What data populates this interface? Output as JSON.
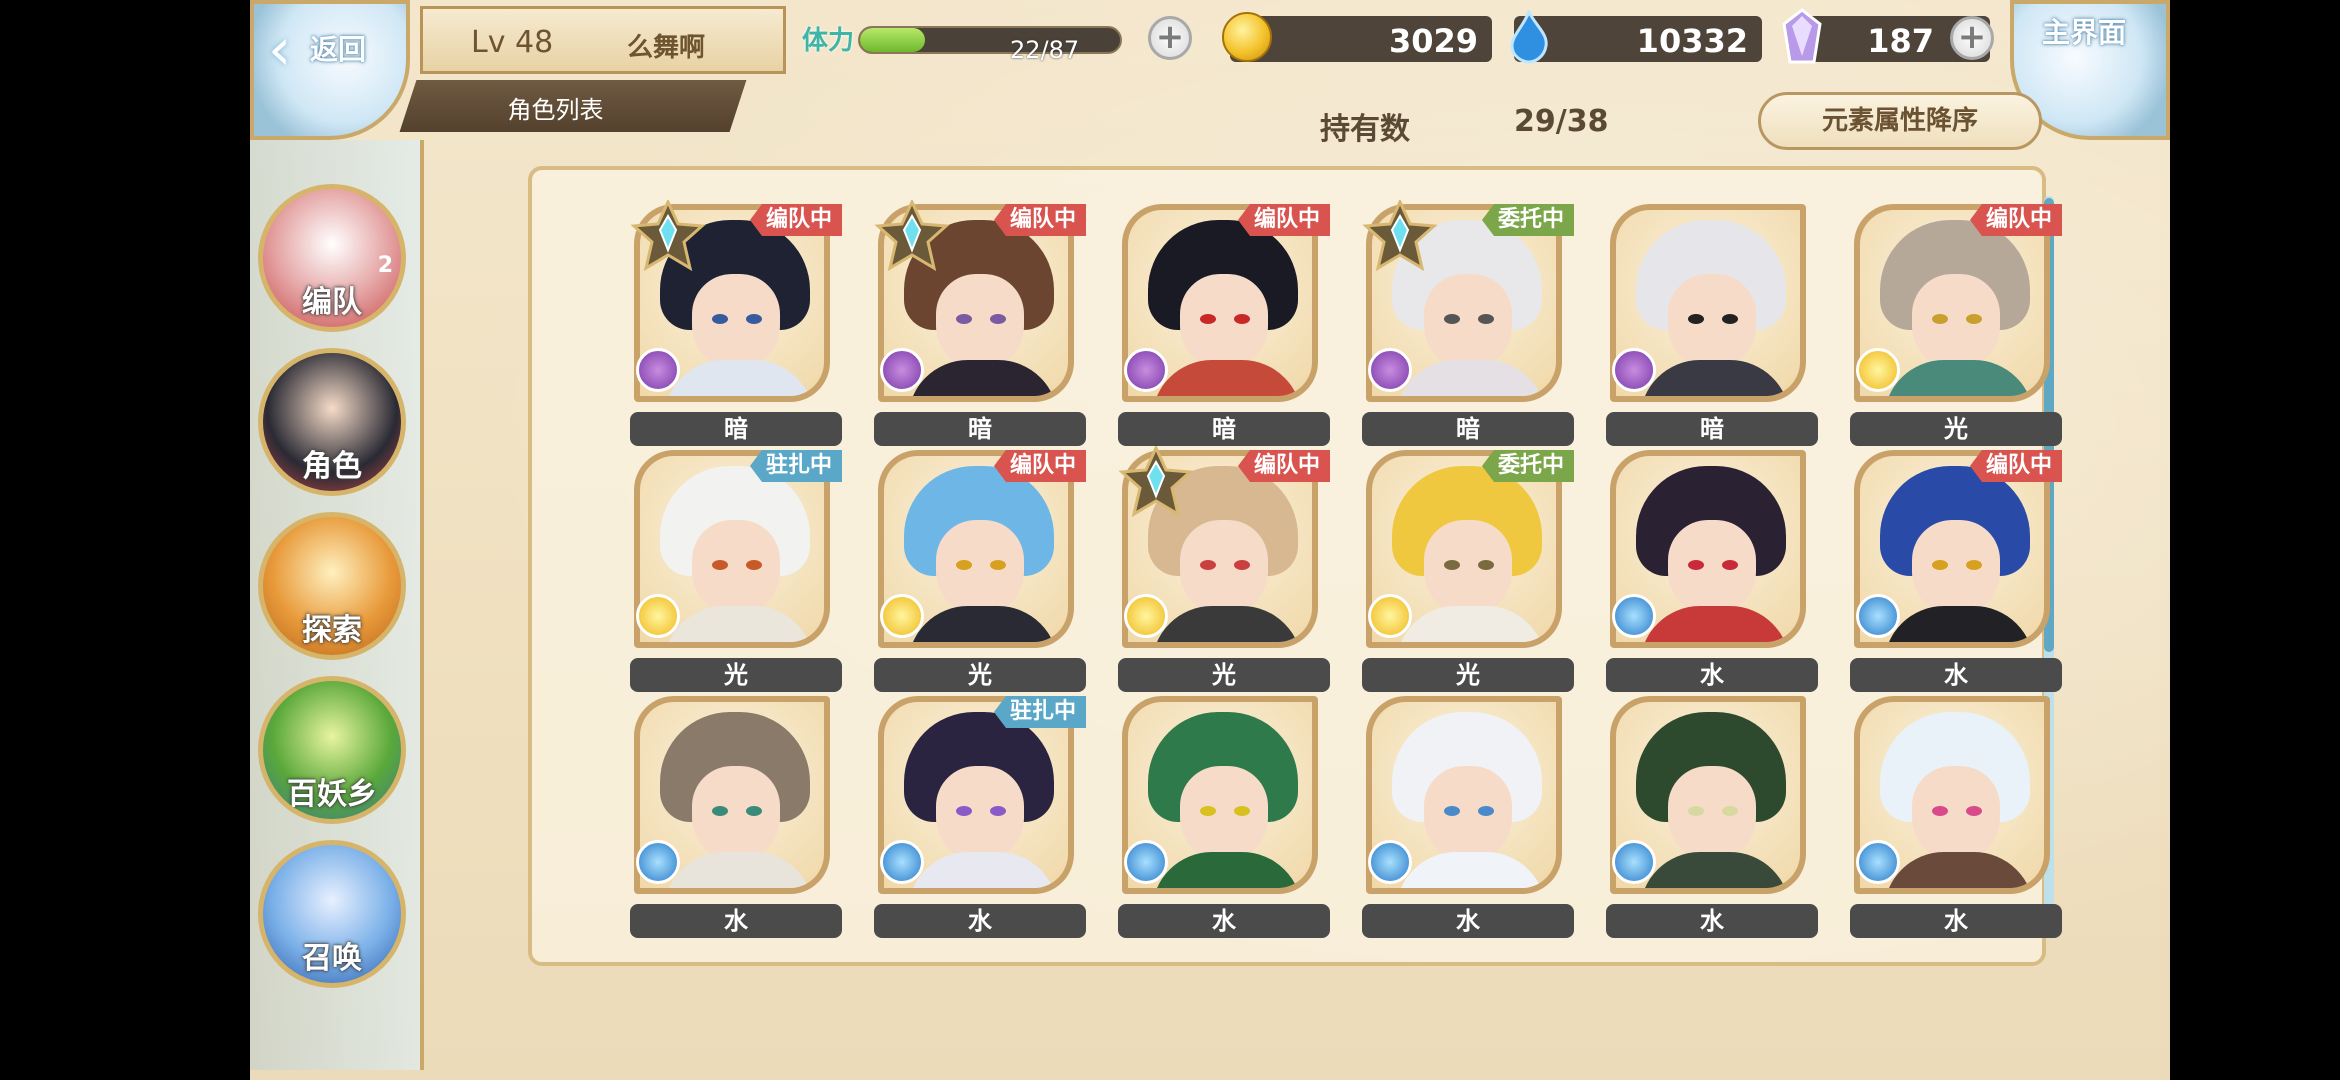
{
  "header": {
    "back_label": "返回",
    "home_label": "主界面",
    "level": "Lv 48",
    "player_name": "么舞啊",
    "section_title": "角色列表",
    "stamina_label": "体力",
    "stamina_value": "22/87",
    "stamina_fraction": 0.25,
    "gold": "3029",
    "spirit": "10332",
    "gems": "187",
    "plus_glyph": "+"
  },
  "toolbar": {
    "owned_label": "持有数",
    "owned_value": "29/38",
    "sort_label": "元素属性降序"
  },
  "nav": [
    {
      "label": "编队",
      "badge": "2",
      "icon": "team-icon"
    },
    {
      "label": "角色",
      "icon": "character-icon"
    },
    {
      "label": "探索",
      "icon": "explore-icon"
    },
    {
      "label": "百妖乡",
      "icon": "village-icon"
    },
    {
      "label": "召唤",
      "icon": "summon-icon"
    }
  ],
  "colors": {
    "tag_team": "#d9534f",
    "tag_commission": "#7ba64a",
    "tag_station": "#5aa7c8",
    "element_dark": "#7a3aa8",
    "element_light": "#f0b81a",
    "element_water": "#2a7cc8"
  },
  "characters": [
    {
      "element": "暗",
      "element_type": "dark",
      "status": "编队中",
      "status_type": "team",
      "starred": true,
      "hair": "#1e2233",
      "eye": "#3a5aa0",
      "outfit": "#dfe6ef"
    },
    {
      "element": "暗",
      "element_type": "dark",
      "status": "编队中",
      "status_type": "team",
      "starred": true,
      "hair": "#6b4530",
      "eye": "#7a5aa0",
      "outfit": "#2a2530"
    },
    {
      "element": "暗",
      "element_type": "dark",
      "status": "编队中",
      "status_type": "team",
      "starred": false,
      "hair": "#1a1a24",
      "eye": "#c82828",
      "outfit": "#c64a3a"
    },
    {
      "element": "暗",
      "element_type": "dark",
      "status": "委托中",
      "status_type": "commission",
      "starred": true,
      "hair": "#e8e8ea",
      "eye": "#555555",
      "outfit": "#e4e0e4"
    },
    {
      "element": "暗",
      "element_type": "dark",
      "status": "",
      "status_type": "",
      "starred": false,
      "hair": "#e6e6ea",
      "eye": "#222222",
      "outfit": "#3a3a44"
    },
    {
      "element": "光",
      "element_type": "light",
      "status": "编队中",
      "status_type": "team",
      "starred": false,
      "hair": "#b5a898",
      "eye": "#c8a030",
      "outfit": "#4a8a7a"
    },
    {
      "element": "光",
      "element_type": "light",
      "status": "驻扎中",
      "status_type": "station",
      "starred": false,
      "hair": "#f2f2f0",
      "eye": "#c85a2a",
      "outfit": "#eae6dc"
    },
    {
      "element": "光",
      "element_type": "light",
      "status": "编队中",
      "status_type": "team",
      "starred": false,
      "hair": "#6eb6e6",
      "eye": "#d8a020",
      "outfit": "#2a2a34"
    },
    {
      "element": "光",
      "element_type": "light",
      "status": "编队中",
      "status_type": "team",
      "starred": true,
      "hair": "#d8b890",
      "eye": "#c84040",
      "outfit": "#3a3a3a"
    },
    {
      "element": "光",
      "element_type": "light",
      "status": "委托中",
      "status_type": "commission",
      "starred": false,
      "hair": "#f0c840",
      "eye": "#7a6a40",
      "outfit": "#f0ece4"
    },
    {
      "element": "水",
      "element_type": "water",
      "status": "",
      "status_type": "",
      "starred": false,
      "hair": "#2a2232",
      "eye": "#c82a3a",
      "outfit": "#c83a3a"
    },
    {
      "element": "水",
      "element_type": "water",
      "status": "编队中",
      "status_type": "team",
      "starred": false,
      "hair": "#2a4aa8",
      "eye": "#d8a020",
      "outfit": "#222226"
    },
    {
      "element": "水",
      "element_type": "water",
      "status": "",
      "status_type": "",
      "starred": false,
      "hair": "#8a7a6a",
      "eye": "#3a8a7a",
      "outfit": "#e8e4dc"
    },
    {
      "element": "水",
      "element_type": "water",
      "status": "驻扎中",
      "status_type": "station",
      "starred": false,
      "hair": "#2a2440",
      "eye": "#8a5ac8",
      "outfit": "#e8e8f0"
    },
    {
      "element": "水",
      "element_type": "water",
      "status": "",
      "status_type": "",
      "starred": false,
      "hair": "#2e7a4a",
      "eye": "#d8c020",
      "outfit": "#2a6a3a"
    },
    {
      "element": "水",
      "element_type": "water",
      "status": "",
      "status_type": "",
      "starred": false,
      "hair": "#f0f2f6",
      "eye": "#4a8ac8",
      "outfit": "#f0f4f8"
    },
    {
      "element": "水",
      "element_type": "water",
      "status": "",
      "status_type": "",
      "starred": false,
      "hair": "#2e4a2e",
      "eye": "#d8d8a0",
      "outfit": "#3a4a3a"
    },
    {
      "element": "水",
      "element_type": "water",
      "status": "",
      "status_type": "",
      "starred": false,
      "hair": "#e8f2f8",
      "eye": "#d84a8a",
      "outfit": "#6a4a3a"
    }
  ]
}
